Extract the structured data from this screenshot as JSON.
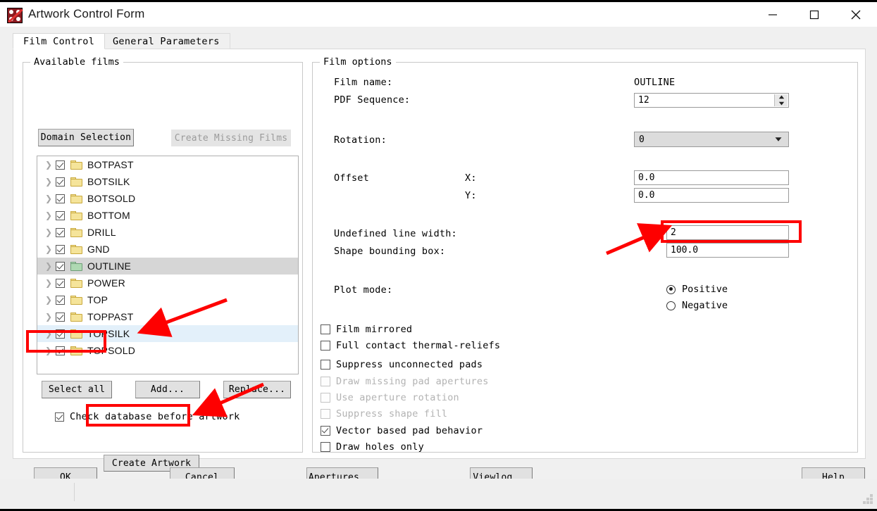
{
  "window": {
    "title": "Artwork Control Form",
    "icon": "artwork-app-icon",
    "minimize": "—",
    "maximize": "□",
    "close": "✕"
  },
  "tabs": [
    {
      "label": "Film Control",
      "selected": true
    },
    {
      "label": "General Parameters",
      "selected": false
    }
  ],
  "available_films": {
    "group_label": "Available films",
    "domain_selection_button": "Domain Selection",
    "create_missing_films_button": "Create Missing Films",
    "create_missing_films_enabled": false,
    "films": [
      {
        "name": "BOTPAST",
        "checked": true,
        "state": "normal",
        "folder": "yellow"
      },
      {
        "name": "BOTSILK",
        "checked": true,
        "state": "normal",
        "folder": "yellow"
      },
      {
        "name": "BOTSOLD",
        "checked": true,
        "state": "normal",
        "folder": "yellow"
      },
      {
        "name": "BOTTOM",
        "checked": true,
        "state": "normal",
        "folder": "yellow"
      },
      {
        "name": "DRILL",
        "checked": true,
        "state": "normal",
        "folder": "yellow"
      },
      {
        "name": "GND",
        "checked": true,
        "state": "normal",
        "folder": "yellow"
      },
      {
        "name": "OUTLINE",
        "checked": true,
        "state": "selected",
        "folder": "green"
      },
      {
        "name": "POWER",
        "checked": true,
        "state": "normal",
        "folder": "yellow"
      },
      {
        "name": "TOP",
        "checked": true,
        "state": "normal",
        "folder": "yellow"
      },
      {
        "name": "TOPPAST",
        "checked": true,
        "state": "normal",
        "folder": "yellow"
      },
      {
        "name": "TOPSILK",
        "checked": true,
        "state": "hover",
        "folder": "yellow"
      },
      {
        "name": "TOPSOLD",
        "checked": true,
        "state": "normal",
        "folder": "yellow"
      }
    ],
    "select_all_button": "Select all",
    "add_button": "Add...",
    "replace_button": "Replace...",
    "check_database_label": "Check database before artwork",
    "check_database_checked": true,
    "create_artwork_button": "Create Artwork"
  },
  "film_options": {
    "group_label": "Film options",
    "film_name_label": "Film name:",
    "film_name_value": "OUTLINE",
    "pdf_sequence_label": "PDF Sequence:",
    "pdf_sequence_value": "12",
    "rotation_label": "Rotation:",
    "rotation_value": "0",
    "offset_label": "Offset",
    "offset_x_label": "X:",
    "offset_x_value": "0.0",
    "offset_y_label": "Y:",
    "offset_y_value": "0.0",
    "undefined_line_width_label": "Undefined line width:",
    "undefined_line_width_value": "2",
    "shape_bounding_box_label": "Shape bounding box:",
    "shape_bounding_box_value": "100.0",
    "plot_mode_label": "Plot mode:",
    "plot_modes": [
      {
        "label": "Positive",
        "selected": true
      },
      {
        "label": "Negative",
        "selected": false
      }
    ],
    "checkboxes": [
      {
        "label": "Film mirrored",
        "checked": false,
        "enabled": true
      },
      {
        "label": "Full contact thermal-reliefs",
        "checked": false,
        "enabled": true
      },
      {
        "label": "Suppress unconnected pads",
        "checked": false,
        "enabled": true
      },
      {
        "label": "Draw missing pad apertures",
        "checked": false,
        "enabled": false
      },
      {
        "label": "Use aperture rotation",
        "checked": false,
        "enabled": false
      },
      {
        "label": "Suppress shape fill",
        "checked": false,
        "enabled": false
      },
      {
        "label": "Vector based pad behavior",
        "checked": true,
        "enabled": true
      },
      {
        "label": "Draw holes only",
        "checked": false,
        "enabled": true
      }
    ]
  },
  "footer": {
    "ok": "OK",
    "cancel": "Cancel",
    "apertures": "Apertures...",
    "viewlog": "Viewlog...",
    "help": "Help"
  },
  "annotations": {
    "highlight_color": "#fe0000",
    "boxes": [
      "select-all-button",
      "create-artwork-button",
      "undefined-line-width-field"
    ],
    "arrows": [
      "arrow-to-select-all",
      "arrow-to-create-artwork",
      "arrow-to-line-width"
    ]
  }
}
